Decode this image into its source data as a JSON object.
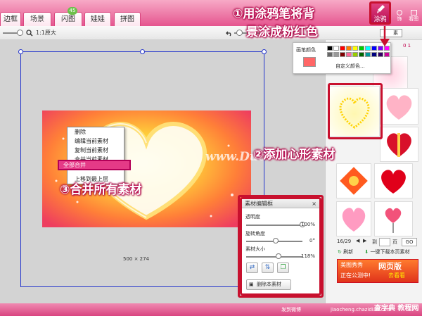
{
  "tabs": [
    {
      "label": "边框"
    },
    {
      "label": "场景"
    },
    {
      "label": "闪图",
      "badge": "45"
    },
    {
      "label": "娃娃"
    },
    {
      "label": "拼图"
    }
  ],
  "top_right": {
    "tuya_label": "涂鸦",
    "small1": "饰",
    "small2": "看图"
  },
  "toolbar": {
    "zoom_text": "1:1原大",
    "right_label": "素"
  },
  "colorpop": {
    "label": "画笔颜色",
    "custom": "自定义颜色...",
    "swatches": [
      "#000000",
      "#ffffff",
      "#ff0000",
      "#ff8000",
      "#ffff00",
      "#00cc00",
      "#00ffff",
      "#0000ff",
      "#8000ff",
      "#ff00ff",
      "#666666",
      "#999999",
      "#800000",
      "#ff6699",
      "#99cc00",
      "#006600",
      "#009999",
      "#000080",
      "#330066",
      "#cc0099"
    ],
    "current": "#ff6666",
    "sidebar_num": "0 1"
  },
  "context_menu": {
    "items": [
      "删除",
      "编辑当前素材",
      "复制当前素材",
      "合并当前素材",
      "全部合并",
      "上移到最上层"
    ],
    "highlighted": "全部合并"
  },
  "canvas": {
    "watermark": "www.DuoTe.com",
    "size_label": "500 × 274"
  },
  "annotations": {
    "step1_line1": "①用涂鸦笔将背",
    "step1_line2": "景涂成粉红色",
    "step2": "②添加心形素材",
    "step3": "③合并所有素材"
  },
  "panel": {
    "page_text": "16/29",
    "goto": "到",
    "page": "页",
    "go": "GO",
    "refresh": "刷新",
    "download": "一键下载本页素材",
    "promo_line1": "美图秀秀",
    "promo_line2": "网页版",
    "promo_line3": "正在公测中!",
    "promo_line4": "去看看"
  },
  "material_dialog": {
    "title": "素材编辑框",
    "opacity_label": "透明度",
    "opacity_value": "100%",
    "rotate_label": "旋转角度",
    "rotate_value": "0°",
    "size_label": "素材大小",
    "size_value": "118%",
    "delete_label": "删除本素材",
    "opacity_level": 1.0,
    "rotate_level": 0.5,
    "size_level": 0.55
  },
  "bottom": {
    "share": "发到微博",
    "site": "jiaocheng.chazidian.com",
    "logo": "查字典 教程网"
  }
}
